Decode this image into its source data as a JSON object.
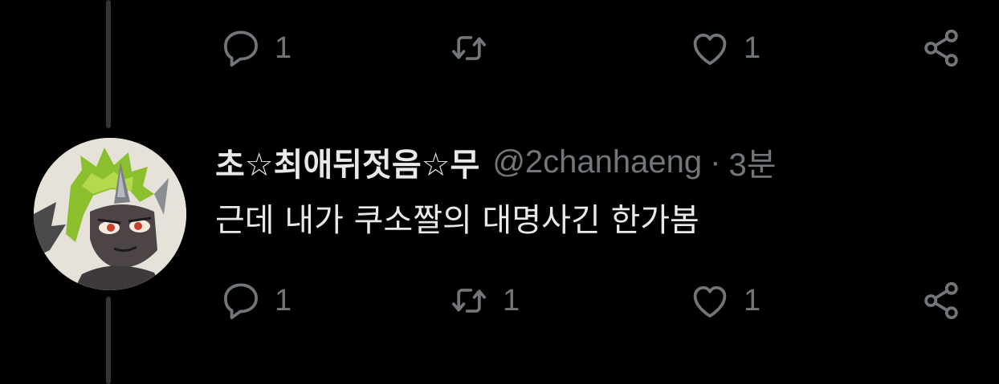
{
  "theme": {
    "background": "#000000",
    "text_primary": "#e7e9ea",
    "text_secondary": "#71767b",
    "thread_line": "#333639"
  },
  "previous_tweet": {
    "actions": {
      "reply": {
        "icon": "reply-icon",
        "count": "1"
      },
      "retweet": {
        "icon": "retweet-icon",
        "count": ""
      },
      "like": {
        "icon": "heart-icon",
        "count": "1"
      },
      "share": {
        "icon": "share-icon"
      }
    }
  },
  "tweet": {
    "avatar": {
      "icon": "avatar-image"
    },
    "display_name": "초☆최애뒤젓음☆무",
    "handle": "@2chanhaeng",
    "separator": "·",
    "timestamp": "3분",
    "text": "근데 내가 쿠소짤의 대명사긴 한가봄",
    "actions": {
      "reply": {
        "icon": "reply-icon",
        "count": "1"
      },
      "retweet": {
        "icon": "retweet-icon",
        "count": "1"
      },
      "like": {
        "icon": "heart-icon",
        "count": "1"
      },
      "share": {
        "icon": "share-icon"
      }
    }
  }
}
